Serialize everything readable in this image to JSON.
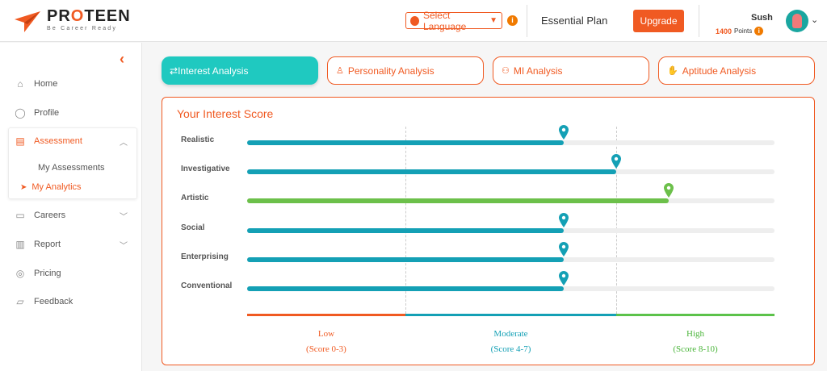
{
  "brand": {
    "name_pre": "PR",
    "name_o": "O",
    "name_post": "TEEN",
    "tagline": "Be Career Ready"
  },
  "header": {
    "language_placeholder": "Select Language",
    "plan": "Essential Plan",
    "upgrade_label": "Upgrade",
    "user_name": "Sush",
    "points_value": "1400",
    "points_label": "Points"
  },
  "sidebar": {
    "items": [
      {
        "label": "Home",
        "icon": "home-icon"
      },
      {
        "label": "Profile",
        "icon": "user-icon"
      },
      {
        "label": "Assessment",
        "icon": "assessment-icon",
        "active": true
      },
      {
        "label": "Careers",
        "icon": "briefcase-icon"
      },
      {
        "label": "Report",
        "icon": "report-icon"
      },
      {
        "label": "Pricing",
        "icon": "pricing-icon"
      },
      {
        "label": "Feedback",
        "icon": "feedback-icon"
      }
    ],
    "assessment_sub": [
      "My Assessments",
      "My Analytics"
    ]
  },
  "tabs": [
    {
      "label": "Interest Analysis",
      "active": true
    },
    {
      "label": "Personality Analysis"
    },
    {
      "label": "MI Analysis"
    },
    {
      "label": "Aptitude Analysis"
    }
  ],
  "card": {
    "title": "Your Interest Score"
  },
  "chart_data": {
    "type": "bar",
    "orientation": "horizontal",
    "categories": [
      "Realistic",
      "Investigative",
      "Artistic",
      "Social",
      "Enterprising",
      "Conventional"
    ],
    "values": [
      6,
      7,
      8,
      6,
      6,
      6
    ],
    "xlim": [
      0,
      10
    ],
    "bands": [
      {
        "label": "Low",
        "range": "(Score 0-3)",
        "color": "#f05a22"
      },
      {
        "label": "Moderate",
        "range": "(Score 4-7)",
        "color": "#14a0b5"
      },
      {
        "label": "High",
        "range": "(Score 8-10)",
        "color": "#5cc24a"
      }
    ]
  },
  "colors": {
    "accent": "#f05a22",
    "teal": "#1fc9c0",
    "bar_moderate": "#14a0b5",
    "bar_high": "#6cc04a"
  }
}
